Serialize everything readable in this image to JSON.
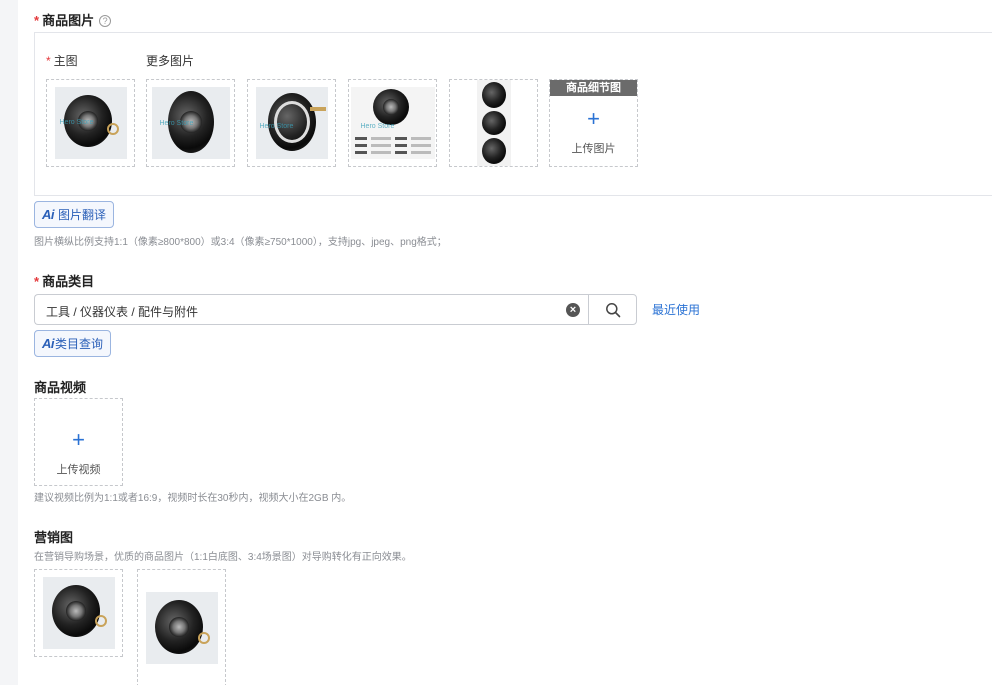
{
  "images_section": {
    "title": "商品图片",
    "help_symbol": "?",
    "main_label": "主图",
    "more_label": "更多图片",
    "watermark": "Hero Store",
    "detail_tag": "商品细节图",
    "upload_label": "上传图片",
    "plus_symbol": "+",
    "translate_ai": "Ai",
    "translate_label": "图片翻译",
    "hint": "图片横纵比例支持1:1（像素≥800*800）或3:4（像素≥750*1000），支持jpg、jpeg、png格式；"
  },
  "category_section": {
    "title": "商品类目",
    "value": "工具 / 仪器仪表 / 配件与附件",
    "clear_symbol": "×",
    "recent_link": "最近使用",
    "query_ai": "Ai",
    "query_label": "类目查询"
  },
  "video_section": {
    "title": "商品视频",
    "plus_symbol": "+",
    "upload_label": "上传视频",
    "hint": "建议视频比例为1:1或者16:9，视频时长在30秒内，视频大小在2GB 内。"
  },
  "marketing_section": {
    "title": "营销图",
    "hint": "在营销导购场景，优质的商品图片（1:1白底图、3:4场景图）对导购转化有正向效果。"
  },
  "required_mark": "*",
  "colors": {
    "accent": "#2a72d4",
    "required": "#e4393c"
  }
}
